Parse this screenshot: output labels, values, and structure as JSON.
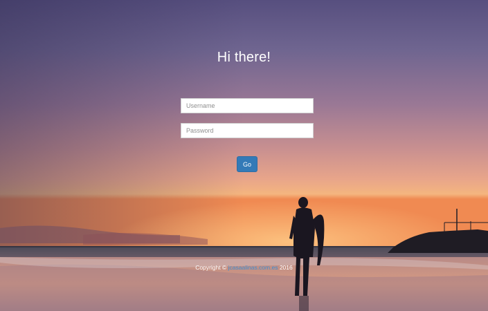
{
  "heading": "Hi there!",
  "login": {
    "username_placeholder": "Username",
    "password_placeholder": "Password",
    "go_label": "Go"
  },
  "footer": {
    "prefix": "Copyright ©",
    "link_text": "jcasaalinas.com.es",
    "year": "2016"
  },
  "colors": {
    "button": "#337ab7",
    "link": "#3d8fd4",
    "text": "#ffffff"
  }
}
